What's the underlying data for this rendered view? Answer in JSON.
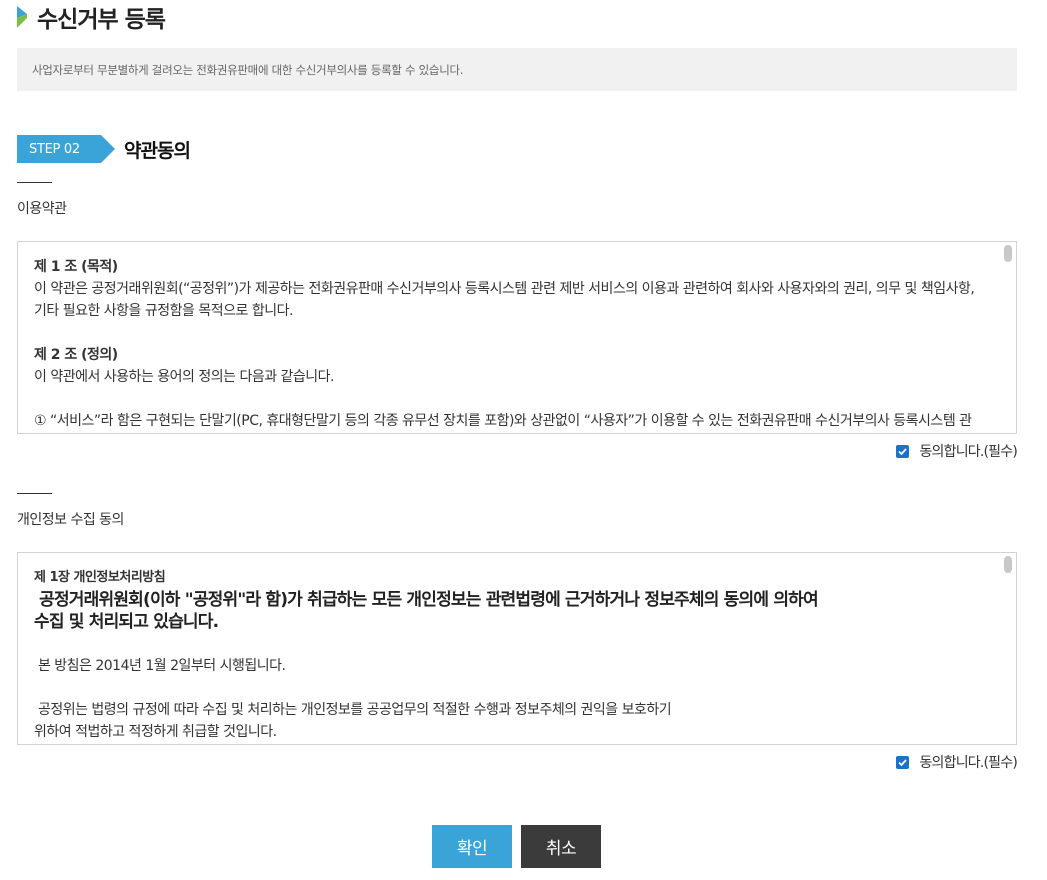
{
  "page": {
    "title": "수신거부 등록",
    "notice": "사업자로부터 무분별하게 걸려오는 전화권유판매에 대한 수신거부의사를 등록할 수 있습니다."
  },
  "step": {
    "badge": "STEP 02",
    "title": "약관동의"
  },
  "terms": {
    "label": "이용약관",
    "article1_title": "제 1 조 (목적)",
    "article1_line1": "이 약관은 공정거래위원회(“공정위”)가 제공하는 전화권유판매 수신거부의사 등록시스템 관련 제반 서비스의 이용과 관련하여 회사와 사용자와의 권리, 의무 및 책임사항,",
    "article1_line2": "기타 필요한 사항을 규정함을 목적으로 합니다.",
    "article2_title": "제 2 조 (정의)",
    "article2_line1": "이 약관에서 사용하는 용어의 정의는 다음과 같습니다.",
    "article2_line2": "① “서비스”라 함은 구현되는 단말기(PC, 휴대형단말기 등의 각종 유무선 장치를 포함)와 상관없이 “사용자”가 이용할 수 있는 전화권유판매 수신거부의사 등록시스템 관",
    "agree_label": "동의합니다.(필수)"
  },
  "privacy": {
    "label": "개인정보 수집 동의",
    "chapter_title": "제 1장 개인정보처리방침",
    "headline1": " 공정거래위원회(이하 \"공정위\"라 함)가 취급하는 모든 개인정보는 관련법령에 근거하거나 정보주체의 동의에 의하여",
    "headline2": "수집 및 처리되고 있습니다.",
    "para1": " 본 방침은 2014년 1월 2일부터 시행됩니다.",
    "para2_line1": " 공정위는 법령의 규정에 따라 수집 및 처리하는 개인정보를 공공업무의 적절한 수행과 정보주체의 권익을 보호하기",
    "para2_line2": "위하여 적법하고 적정하게 취급할 것입니다.",
    "agree_label": "동의합니다.(필수)"
  },
  "buttons": {
    "confirm": "확인",
    "cancel": "취소"
  },
  "colors": {
    "accent": "#3aa3d8",
    "checkbox": "#1a73c9",
    "cancel_button": "#3b3b3b",
    "notice_bg": "#f1f1f1"
  }
}
